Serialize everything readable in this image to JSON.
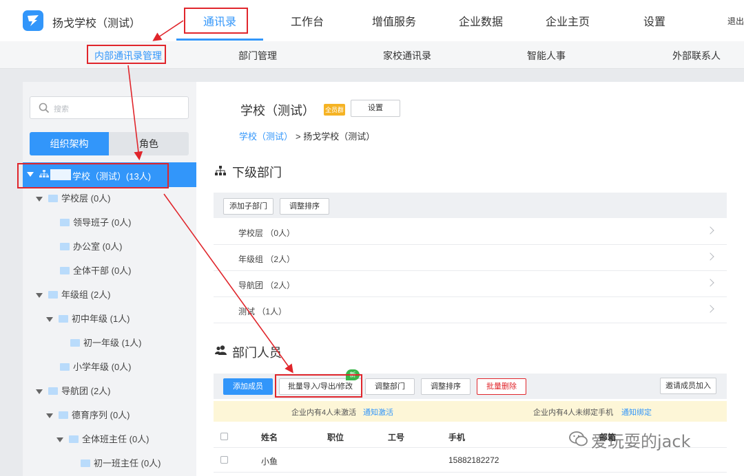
{
  "topbar": {
    "app_title": "扬戈学校（测试）",
    "nav": [
      "通讯录",
      "工作台",
      "增值服务",
      "企业数据",
      "企业主页",
      "设置"
    ],
    "logout": "退出"
  },
  "subnav": [
    "内部通讯录管理",
    "部门管理",
    "家校通讯录",
    "智能人事",
    "外部联系人"
  ],
  "sidebar": {
    "search_placeholder": "搜索",
    "seg_org": "组织架构",
    "seg_role": "角色",
    "root_label": "学校（测试）(13人)",
    "tree": [
      {
        "label": "学校层 (0人)"
      },
      {
        "label": "领导班子 (0人)"
      },
      {
        "label": "办公室 (0人)"
      },
      {
        "label": "全体干部 (0人)"
      },
      {
        "label": "年级组 (2人)"
      },
      {
        "label": "初中年级 (1人)"
      },
      {
        "label": "初一年级 (1人)"
      },
      {
        "label": "小学年级 (0人)"
      },
      {
        "label": "导航团 (2人)"
      },
      {
        "label": "德育序列 (0人)"
      },
      {
        "label": "全体班主任 (0人)"
      },
      {
        "label": "初一班主任 (0人)"
      }
    ]
  },
  "main": {
    "title": "学校（测试）",
    "badge": "全员群",
    "setting_button": "设置",
    "crumb_link": "学校（测试）",
    "crumb_current": "> 扬戈学校（测试）",
    "sub_section_title": "下级部门",
    "add_sub_btn": "添加子部门",
    "sort_btn": "调整排序",
    "sub_departments": [
      "学校层 （0人）",
      "年级组 （2人）",
      "导航团 （2人）",
      "测试 （1人）"
    ],
    "members_title": "部门人员",
    "member_buttons": {
      "add": "添加成员",
      "batch": "批量导入/导出/修改",
      "adjust_dept": "调整部门",
      "adjust_sort": "调整排序",
      "batch_delete": "批量删除",
      "invite": "邀请成员加入"
    },
    "new_badge": "新",
    "notice": {
      "left_text": "企业内有4人未激活",
      "left_link": "通知激活",
      "right_text": "企业内有4人未绑定手机",
      "right_link": "通知绑定"
    },
    "table_headers": [
      "姓名",
      "职位",
      "工号",
      "手机",
      "邮箱"
    ],
    "rows": [
      {
        "name": "小鱼",
        "phone": "15882182272"
      }
    ]
  },
  "watermark": "爱玩耍的jack",
  "colors": {
    "accent": "#3296fa",
    "annotation": "#e0252b"
  }
}
